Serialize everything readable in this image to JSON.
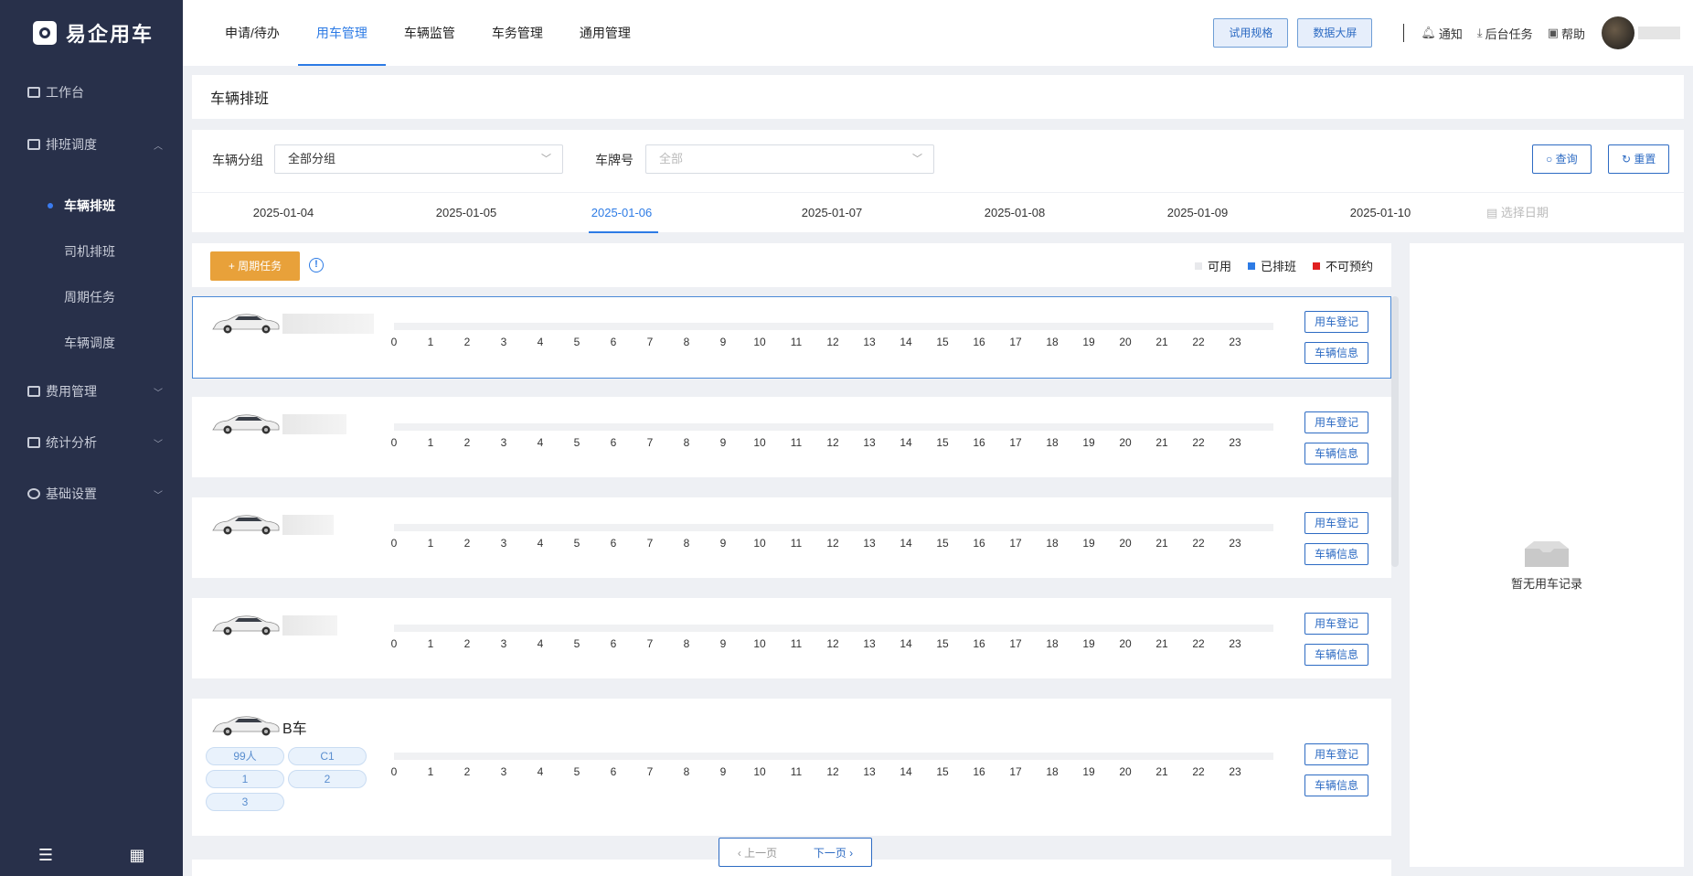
{
  "app": {
    "name": "易企用车"
  },
  "sidebar": {
    "items": [
      {
        "label": "工作台"
      },
      {
        "label": "排班调度"
      },
      {
        "label": "费用管理"
      },
      {
        "label": "统计分析"
      },
      {
        "label": "基础设置"
      }
    ],
    "sub_items": [
      {
        "label": "车辆排班"
      },
      {
        "label": "司机排班"
      },
      {
        "label": "周期任务"
      },
      {
        "label": "车辆调度"
      }
    ]
  },
  "header": {
    "tabs": [
      {
        "label": "申请/待办"
      },
      {
        "label": "用车管理"
      },
      {
        "label": "车辆监管"
      },
      {
        "label": "车务管理"
      },
      {
        "label": "通用管理"
      }
    ],
    "btn_trial": "试用规格",
    "btn_dashboard": "数据大屏",
    "notify": "通知",
    "tasks": "后台任务",
    "help": "帮助"
  },
  "page": {
    "title": "车辆排班"
  },
  "filters": {
    "group_label": "车辆分组",
    "group_value": "全部分组",
    "plate_label": "车牌号",
    "plate_placeholder": "全部",
    "query": "查询",
    "reset": "重置"
  },
  "dates": {
    "items": [
      "2025-01-04",
      "2025-01-05",
      "2025-01-06",
      "2025-01-07",
      "2025-01-08",
      "2025-01-09",
      "2025-01-10"
    ],
    "active": "2025-01-06",
    "picker": "选择日期"
  },
  "toolbar": {
    "periodic": "周期任务",
    "info": "!",
    "legend": [
      {
        "label": "可用",
        "color": "#e8e9ec"
      },
      {
        "label": "已排班",
        "color": "#2d7be5"
      },
      {
        "label": "不可预约",
        "color": "#e02020"
      }
    ]
  },
  "hours": [
    "0",
    "1",
    "2",
    "3",
    "4",
    "5",
    "6",
    "7",
    "8",
    "9",
    "10",
    "11",
    "12",
    "13",
    "14",
    "15",
    "16",
    "17",
    "18",
    "19",
    "20",
    "21",
    "22",
    "23"
  ],
  "vehicles": [
    {
      "name": "",
      "tags": []
    },
    {
      "name": "",
      "tags": []
    },
    {
      "name": "",
      "tags": []
    },
    {
      "name": "",
      "tags": []
    },
    {
      "name": "B车",
      "tags": [
        "99人",
        "C1",
        "1",
        "2",
        "3"
      ]
    }
  ],
  "vehicle_buttons": {
    "register": "用车登记",
    "info": "车辆信息"
  },
  "pager": {
    "prev": "上一页",
    "next": "下一页"
  },
  "side_panel": {
    "empty": "暂无用车记录"
  }
}
